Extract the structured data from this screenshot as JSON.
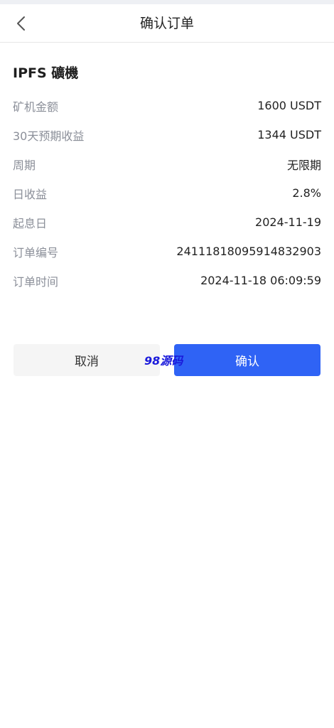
{
  "header": {
    "title": "确认订单",
    "back_icon": "chevron-left-icon"
  },
  "product": {
    "name": "IPFS 礦機"
  },
  "details": [
    {
      "label": "矿机金额",
      "value": "1600 USDT"
    },
    {
      "label": "30天预期收益",
      "value": "1344 USDT"
    },
    {
      "label": "周期",
      "value": "无限期"
    },
    {
      "label": "日收益",
      "value": "2.8%"
    },
    {
      "label": "起息日",
      "value": "2024-11-19"
    },
    {
      "label": "订单编号",
      "value": "24111818095914832903"
    },
    {
      "label": "订单时间",
      "value": "2024-11-18 06:09:59"
    }
  ],
  "actions": {
    "cancel_label": "取消",
    "confirm_label": "确认"
  },
  "watermark": {
    "text": "98源码"
  },
  "colors": {
    "primary": "#2f63f5",
    "cancel_bg": "#f5f5f5",
    "label_gray": "#8b8f99",
    "watermark": "#1a1adb"
  }
}
